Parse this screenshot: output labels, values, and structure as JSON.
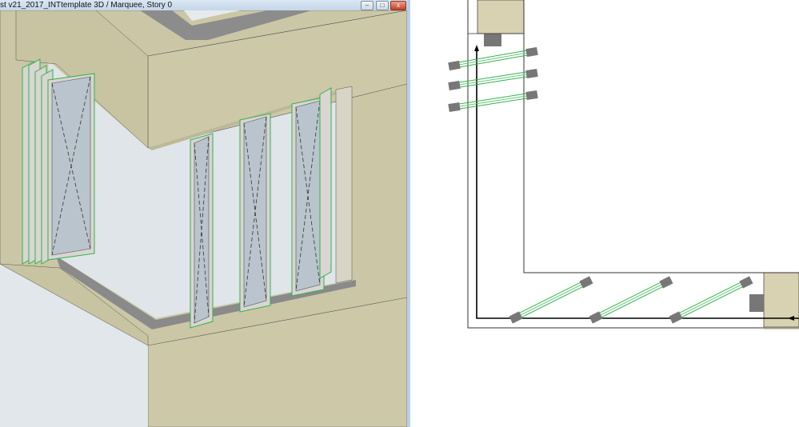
{
  "window": {
    "title": "st v21_2017_INTtemplate 3D / Marquee, Story 0",
    "minimize_label": "–",
    "maximize_label": "□",
    "close_label": "x"
  },
  "colors": {
    "wall": "#cbc7a6",
    "sill": "#8a8a8a",
    "glass": "#b9c4cc",
    "frame_edge": "#2fb34a",
    "background": "#e1e7ea"
  }
}
